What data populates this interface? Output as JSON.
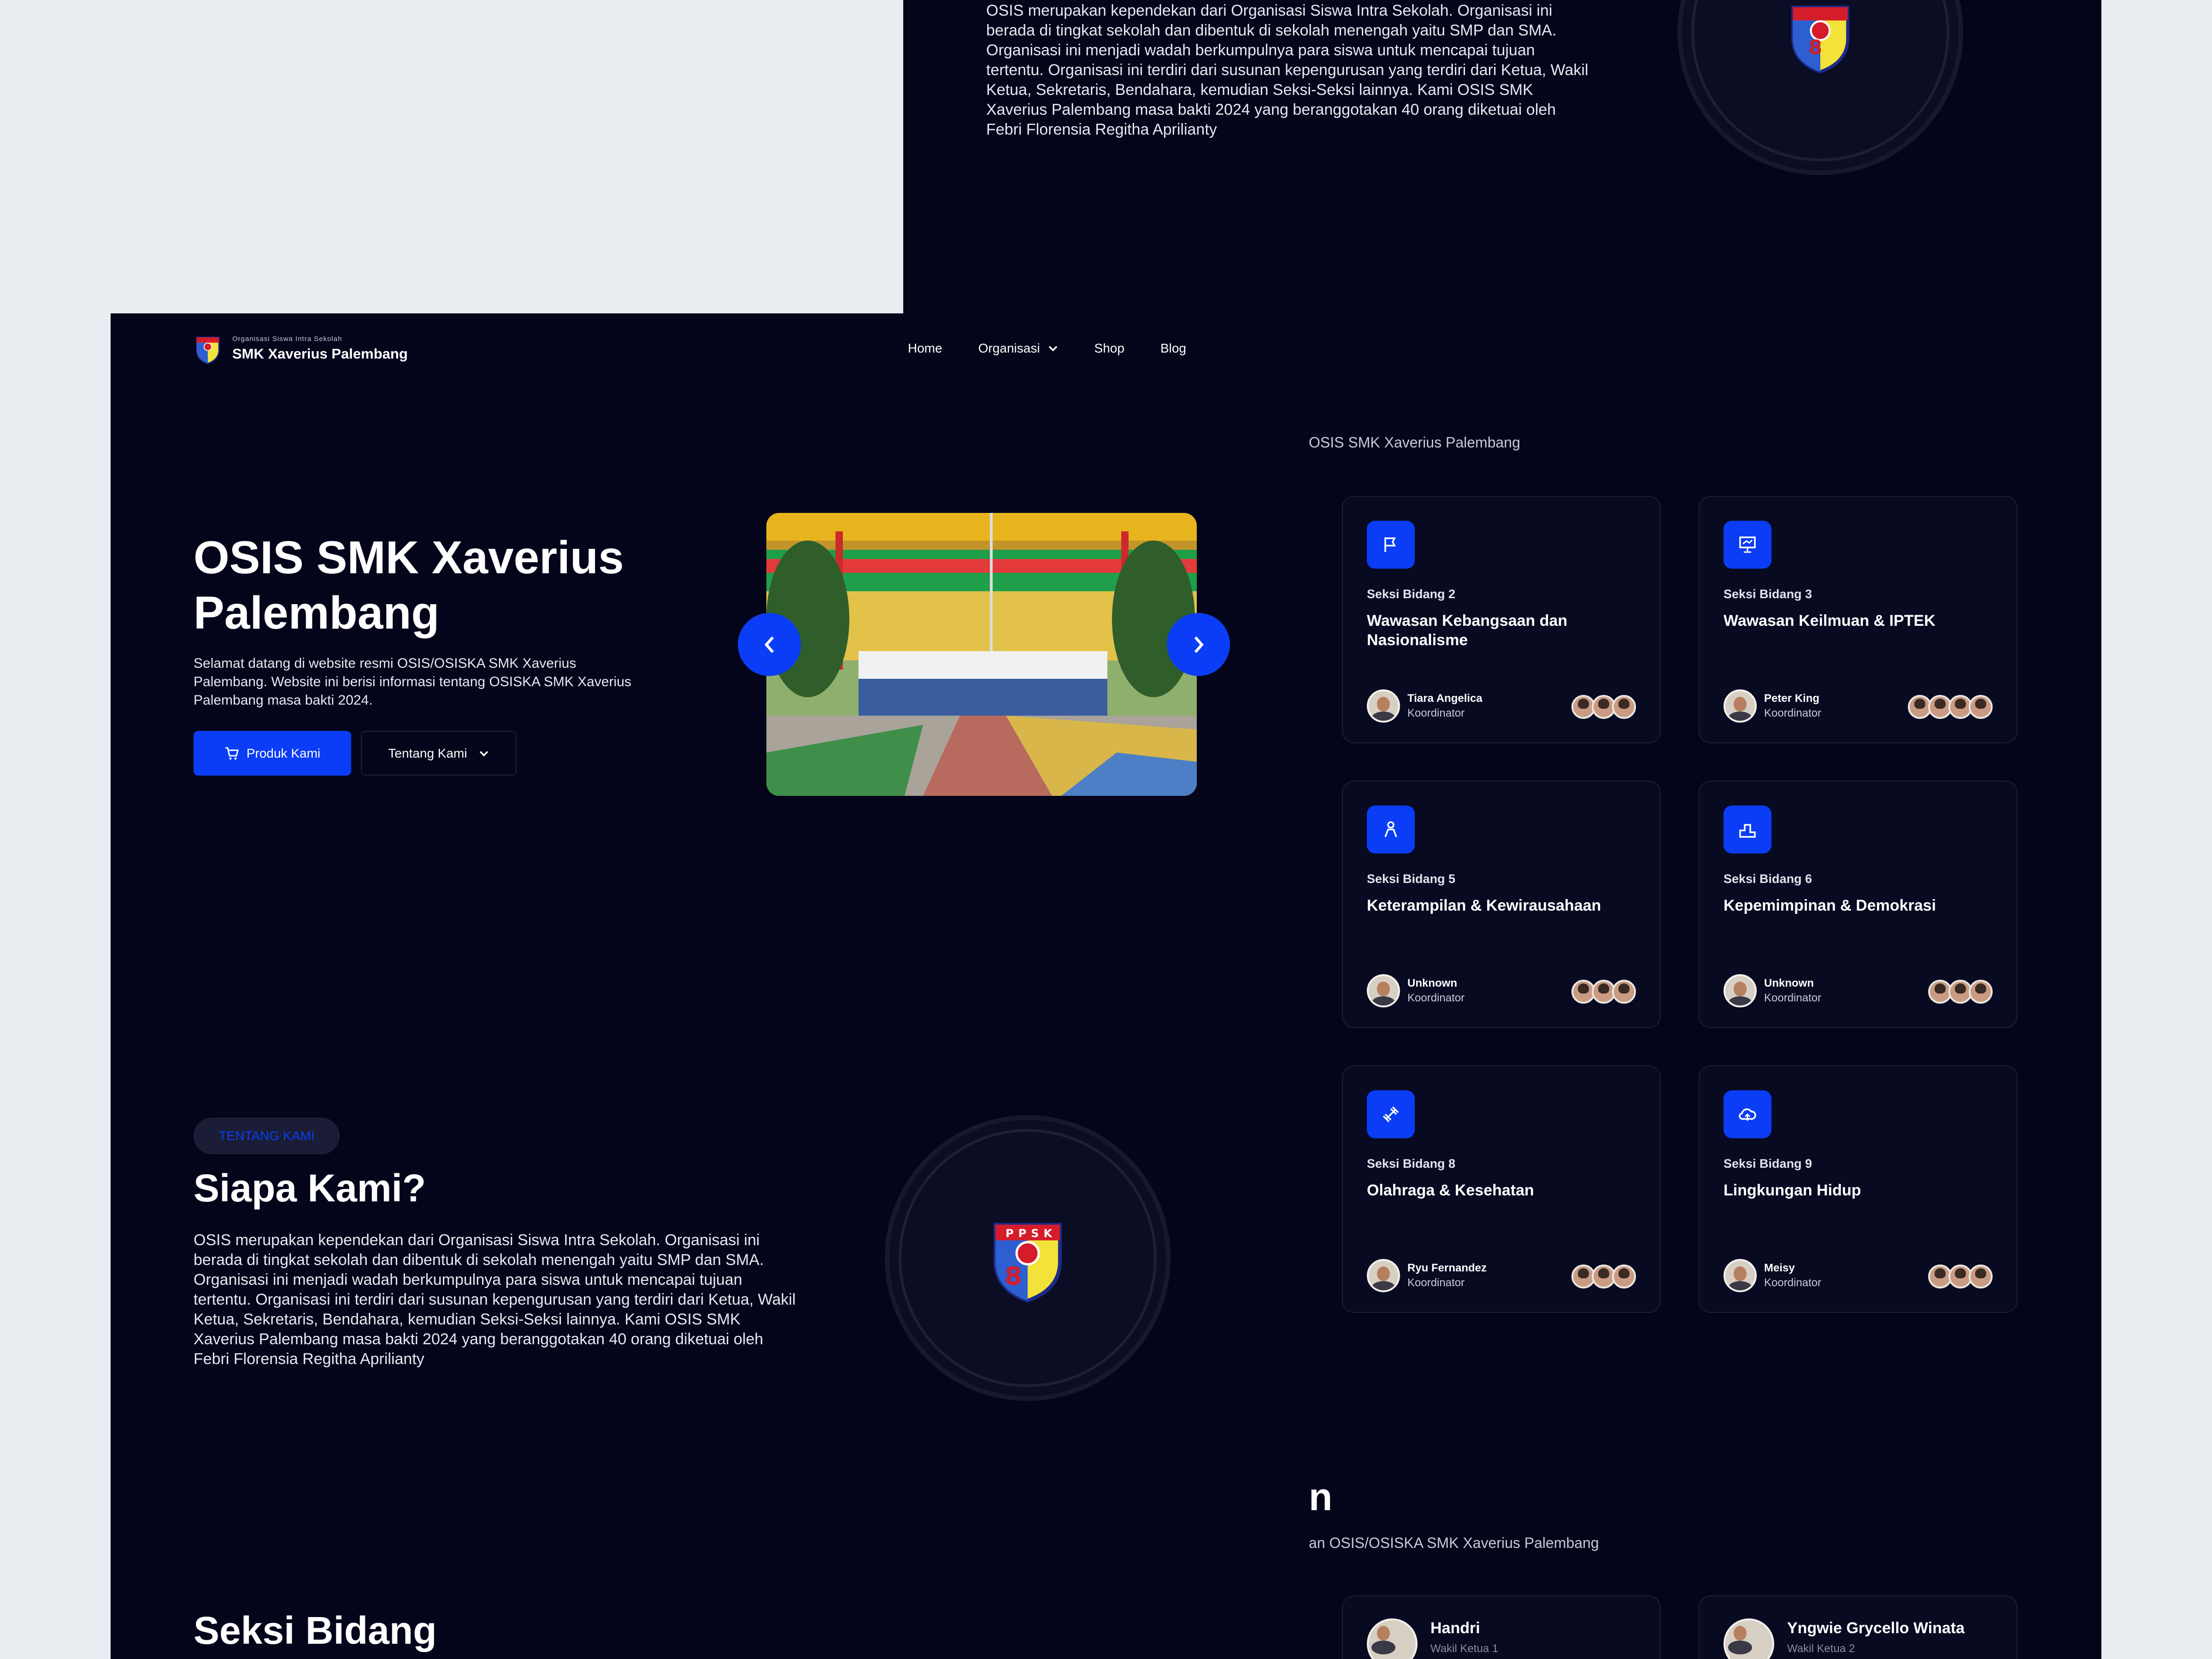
{
  "brand": {
    "tagline": "Organisasi Siswa Intra Sekolah",
    "name": "SMK Xaverius Palembang"
  },
  "nav": {
    "home": "Home",
    "organisasi": "Organisasi",
    "shop": "Shop",
    "blog": "Blog"
  },
  "hero": {
    "title": "OSIS SMK Xaverius Palembang",
    "description": "Selamat datang di website resmi OSIS/OSISKA SMK Xaverius Palembang. Website ini berisi informasi tentang OSISKA SMK Xaverius Palembang masa bakti 2024.",
    "primary_button": "Produk Kami",
    "secondary_button": "Tentang Kami"
  },
  "about": {
    "pill": "TENTANG KAMI",
    "title": "Siapa Kami?",
    "paragraph": "OSIS merupakan kependekan dari Organisasi Siswa Intra Sekolah. Organisasi ini berada di tingkat sekolah dan dibentuk di sekolah menengah yaitu SMP dan SMA. Organisasi ini menjadi wadah berkumpulnya para siswa untuk mencapai tujuan tertentu. Organisasi ini terdiri dari susunan kepengurusan yang terdiri dari Ketua, Wakil Ketua, Sekretaris, Bendahara, kemudian Seksi-Seksi lainnya.  Kami OSIS SMK Xaverius Palembang masa bakti 2024 yang beranggotakan 40 orang diketuai oleh Febri Florensia Regitha Aprilianty",
    "emblem_text": "PPSK"
  },
  "seksi": {
    "title": "Seksi Bidang",
    "subtitle_partial": "OSIS SMK Xaverius Palembang",
    "cards": [
      {
        "sub": "Seksi Bidang 2",
        "title": "Wawasan Kebangsaan dan Nasionalisme",
        "name": "Tiara Angelica",
        "role": "Koordinator",
        "icon": "flag-icon"
      },
      {
        "sub": "Seksi Bidang 3",
        "title": "Wawasan Keilmuan & IPTEK",
        "name": "Peter King",
        "role": "Koordinator",
        "icon": "presentation-icon"
      },
      {
        "sub": "Seksi Bidang 5",
        "title": "Keterampilan & Kewirausahaan",
        "name": "Unknown",
        "role": "Koordinator",
        "icon": "person-icon"
      },
      {
        "sub": "Seksi Bidang 6",
        "title": "Kepemimpinan & Demokrasi",
        "name": "Unknown",
        "role": "Koordinator",
        "icon": "podium-icon"
      },
      {
        "sub": "Seksi Bidang 8",
        "title": "Olahraga & Kesehatan",
        "name": "Ryu Fernandez",
        "role": "Koordinator",
        "icon": "dumbbell-icon"
      },
      {
        "sub": "Seksi Bidang 9",
        "title": "Lingkungan Hidup",
        "name": "Meisy",
        "role": "Koordinator",
        "icon": "cloud-icon"
      }
    ]
  },
  "pengurus": {
    "title_partial": "n",
    "subtitle_partial": "an OSIS/OSISKA SMK Xaverius Palembang",
    "people": [
      {
        "name": "Handri",
        "role": "Wakil Ketua 1"
      },
      {
        "name": "Yngwie Grycello Winata",
        "role": "Wakil Ketua 2"
      }
    ]
  },
  "colors": {
    "background": "#04051b",
    "accent": "#0a3df5",
    "page_bg": "#e9edf1"
  }
}
